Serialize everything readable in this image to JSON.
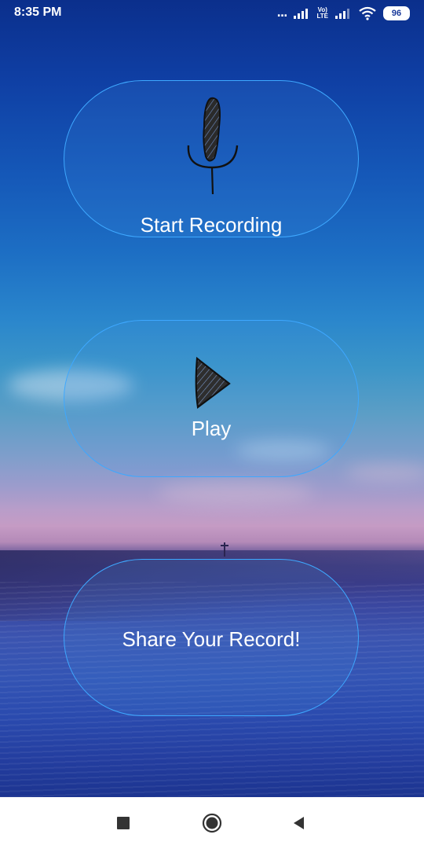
{
  "status_bar": {
    "time": "8:35 PM",
    "dots": "...",
    "volte_top": "Vo)",
    "volte_bottom": "LTE",
    "battery": "96"
  },
  "buttons": {
    "record": {
      "label": "Start Recording",
      "icon": "microphone-icon"
    },
    "play": {
      "label": "Play",
      "icon": "play-icon"
    },
    "share": {
      "label": "Share Your Record!"
    }
  },
  "nav": {
    "recents_icon": "square-icon",
    "home_icon": "circle-icon",
    "back_icon": "triangle-back-icon"
  },
  "colors": {
    "button_border": "#3ea8ff",
    "button_text": "#ffffff",
    "nav_icon": "#333333"
  }
}
